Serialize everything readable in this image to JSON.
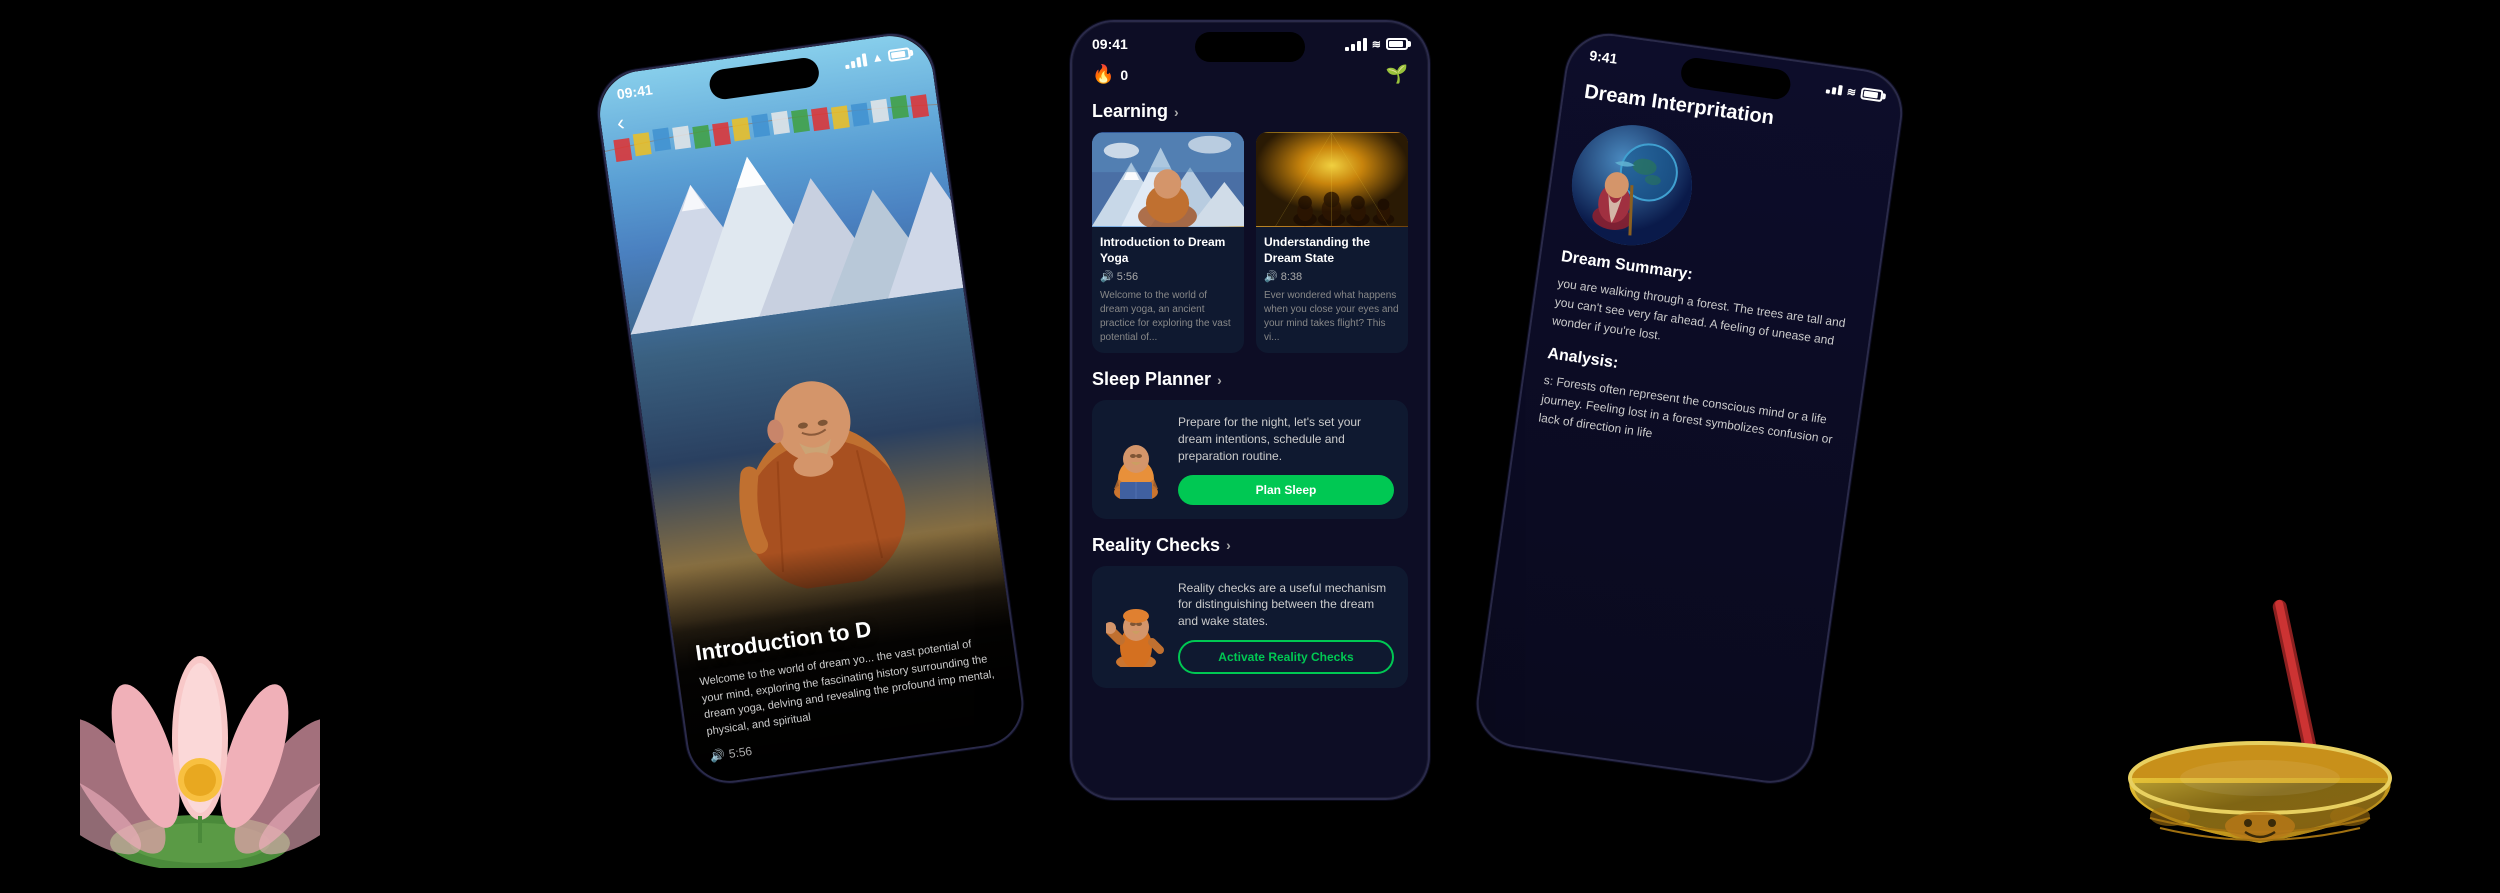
{
  "background": "#000000",
  "leftPhone": {
    "statusTime": "09:41",
    "contentTitle": "Introduction to D",
    "contentDesc": "Welcome to the world of dream yo... the vast potential of your mind, exploring the fascinating history surrounding the dream yoga, delving and revealing the profound imp mental, physical, and spiritual",
    "duration": "5:56",
    "backButtonLabel": "‹"
  },
  "centerPhone": {
    "statusTime": "09:41",
    "coins": "0",
    "plantIcon": "🌱",
    "sections": {
      "learning": {
        "label": "Learning",
        "chevron": "›",
        "card1": {
          "title": "Introduction to Dream Yoga",
          "duration": "5:56",
          "description": "Welcome to the world of dream yoga, an ancient practice for exploring the vast potential of..."
        },
        "card2": {
          "title": "Understanding the Dream State",
          "duration": "8:38",
          "description": "Ever wondered what happens when you close your eyes and your mind takes flight? This vi..."
        }
      },
      "sleepPlanner": {
        "label": "Sleep Planner",
        "chevron": "›",
        "description": "Prepare for the night, let's set your dream intentions, schedule and preparation routine.",
        "buttonLabel": "Plan Sleep"
      },
      "realityChecks": {
        "label": "Reality Checks",
        "chevron": "›",
        "description": "Reality checks are a useful mechanism for distinguishing between the dream and wake states.",
        "buttonLabel": "Activate Reality Checks"
      }
    }
  },
  "rightPhone": {
    "statusTime": "9:41",
    "title": "Dream Interpritation",
    "dreamSummaryLabel": "Dream Summary:",
    "dreamSummaryText": "you are walking through a forest. The trees are tall and you can't see very far ahead. A feeling of unease and wonder if you're lost.",
    "analysisLabel": "Analysis:",
    "analysisText": "s: Forests often represent the conscious mind or a life journey. Feeling lost in a forest symbolizes confusion or lack of direction in life"
  }
}
